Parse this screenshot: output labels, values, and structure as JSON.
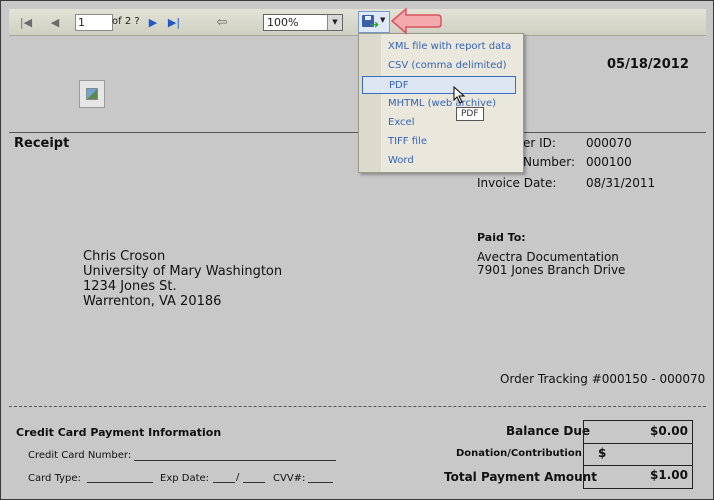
{
  "toolbar": {
    "page_value": "1",
    "page_of": "of 2 ?",
    "zoom_value": "100%",
    "icons": {
      "first_page": "first-page-icon",
      "previous_page": "previous-page-icon",
      "next_page": "next-page-icon",
      "last_page": "last-page-icon",
      "back": "back-icon",
      "export": "export-disk-icon"
    }
  },
  "export_menu": {
    "items": [
      "XML file with report data",
      "CSV (comma delimited)",
      "PDF",
      "MHTML (web archive)",
      "Excel",
      "TIFF file",
      "Word"
    ],
    "hovered": "PDF",
    "tooltip": "PDF"
  },
  "report": {
    "date": "05/18/2012",
    "title": "Receipt",
    "customer_id_label": "er ID:",
    "customer_id": "000070",
    "invoice_number_label": "Number:",
    "invoice_number": "000100",
    "invoice_date_label": "Invoice Date:",
    "invoice_date": "08/31/2011",
    "bill_to": [
      "Chris Croson",
      "University of Mary Washington",
      "1234 Jones St.",
      "Warrenton,  VA  20186"
    ],
    "paid_to_label": "Paid To:",
    "paid_to": [
      "Avectra Documentation",
      "7901 Jones Branch Drive"
    ],
    "order_tracking": "Order Tracking #000150 - 000070"
  },
  "payment": {
    "title": "Credit Card Payment Information",
    "cc_number_label": "Credit Card Number:",
    "card_type_label": "Card Type:",
    "exp_date_label": "Exp Date:",
    "exp_sep": "/",
    "cvv_label": "CVV#:",
    "balance_due_label": "Balance Due",
    "balance_due": "$0.00",
    "donation_label": "Donation/Contribution",
    "donation_value": "$",
    "total_label": "Total Payment Amount",
    "total_value": "$1.00"
  },
  "colors": {
    "accent": "#3563b8",
    "callout": "#e8838a"
  }
}
